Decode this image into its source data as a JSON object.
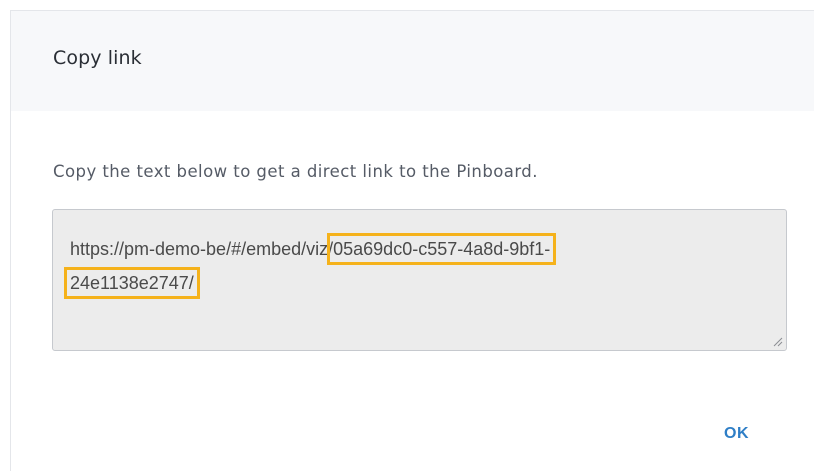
{
  "dialog": {
    "title": "Copy link",
    "description": "Copy the text below to get a direct link to the Pinboard.",
    "link": {
      "prefix": "https://pm-demo-be/#/embed/viz/",
      "highlighted_line1": "05a69dc0-c557-4a8d-9bf1-",
      "highlighted_line2": "24e1138e2747/"
    },
    "ok_label": "OK"
  },
  "colors": {
    "accent": "#2e7ec6",
    "highlight": "#f5b21b",
    "header_bg": "#f7f8fa",
    "textarea_bg": "#ececec"
  }
}
